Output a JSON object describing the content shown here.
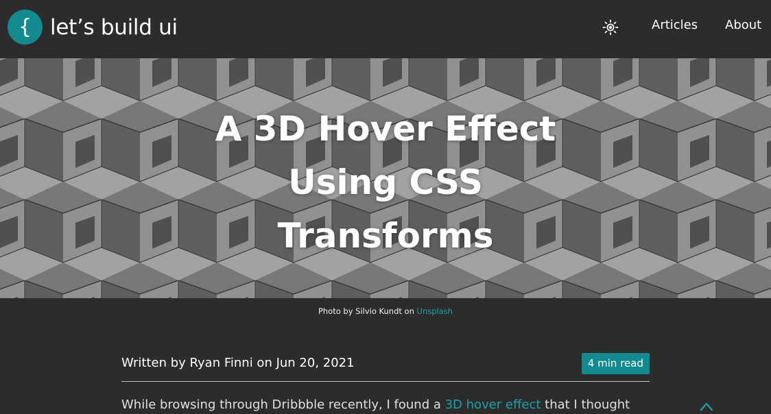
{
  "header": {
    "logo_mark": "{",
    "logo_text": "let’s build ui",
    "theme_icon": "sun-icon",
    "nav": [
      {
        "label": "Articles"
      },
      {
        "label": "About"
      }
    ]
  },
  "hero": {
    "title_lines": [
      "A 3D Hover Effect",
      "Using CSS",
      "Transforms"
    ]
  },
  "credit": {
    "prefix": "Photo by Silvio Kundt on ",
    "link": "Unsplash"
  },
  "article": {
    "written_by": "Written by Ryan Finni on Jun 20, 2021",
    "read_time": "4 min read",
    "intro_before": "While browsing through Dribbble recently, I found a ",
    "intro_link": "3D hover effect",
    "intro_after": " that I thought"
  },
  "colors": {
    "background": "#2c2c2c",
    "accent": "#138a90",
    "link": "#1aa3a8"
  },
  "icons": {
    "scroll_up": "chevron-up-icon"
  }
}
